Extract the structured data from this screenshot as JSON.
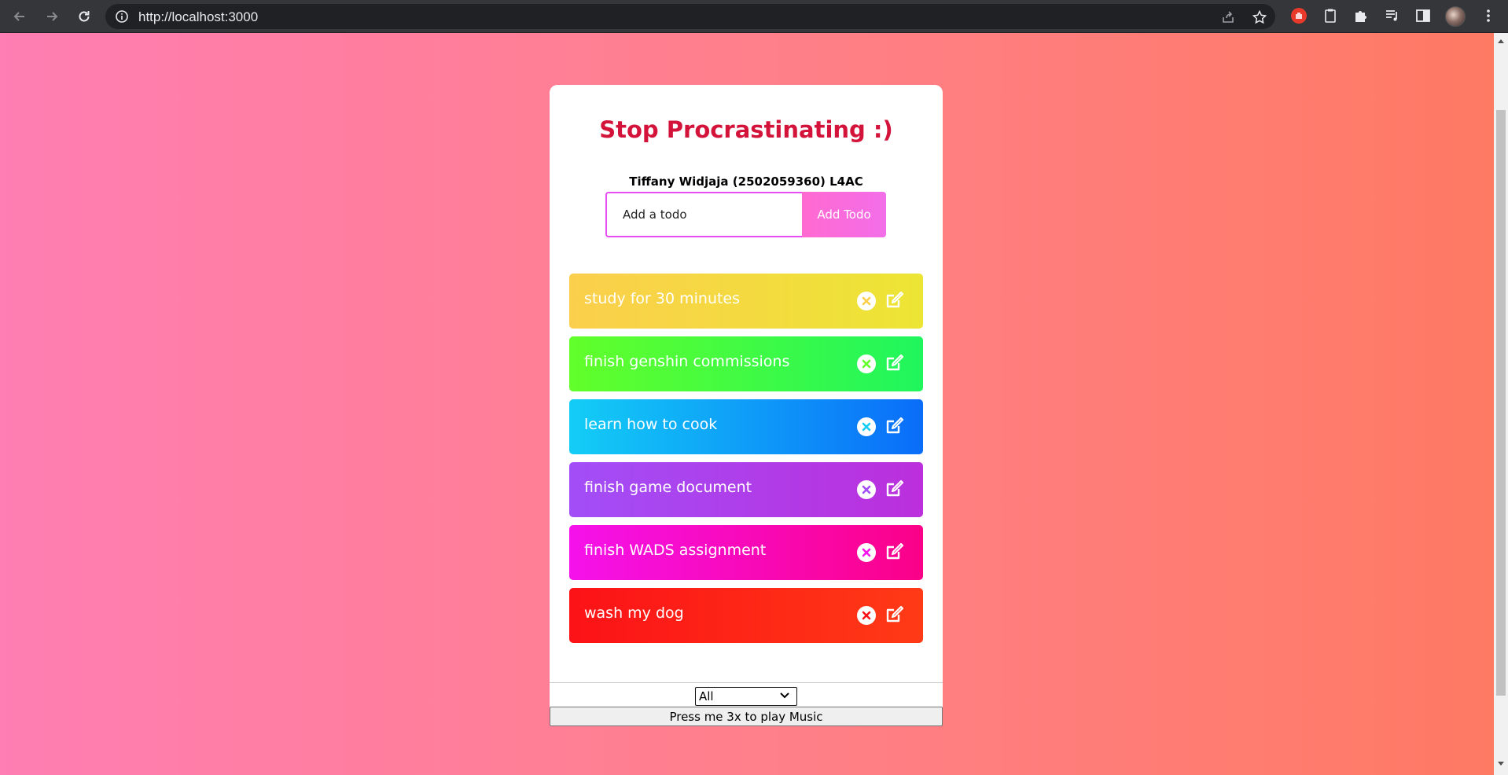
{
  "browser": {
    "url": "http://localhost:3000"
  },
  "app": {
    "title": "Stop Procrastinating :)",
    "subtitle": "Tiffany Widjaja (2502059360) L4AC",
    "input_placeholder": "Add a todo",
    "add_button": "Add Todo",
    "todos": [
      {
        "text": "study for 30 minutes",
        "colors": [
          "#fbcf4c",
          "#ece534"
        ]
      },
      {
        "text": "finish genshin commissions",
        "colors": [
          "#62ff2a",
          "#1ff65d"
        ]
      },
      {
        "text": "learn how to cook",
        "colors": [
          "#13cdf6",
          "#0a6df9"
        ]
      },
      {
        "text": "finish game document",
        "colors": [
          "#a24ef7",
          "#bb2fdc"
        ]
      },
      {
        "text": "finish WADS assignment",
        "colors": [
          "#f512eb",
          "#fb0188"
        ]
      },
      {
        "text": "wash my dog",
        "colors": [
          "#fc1217",
          "#ff3a16"
        ]
      }
    ],
    "filter": {
      "selected": "All",
      "options": [
        "All"
      ]
    },
    "music_button": "Press me 3x to play Music"
  }
}
